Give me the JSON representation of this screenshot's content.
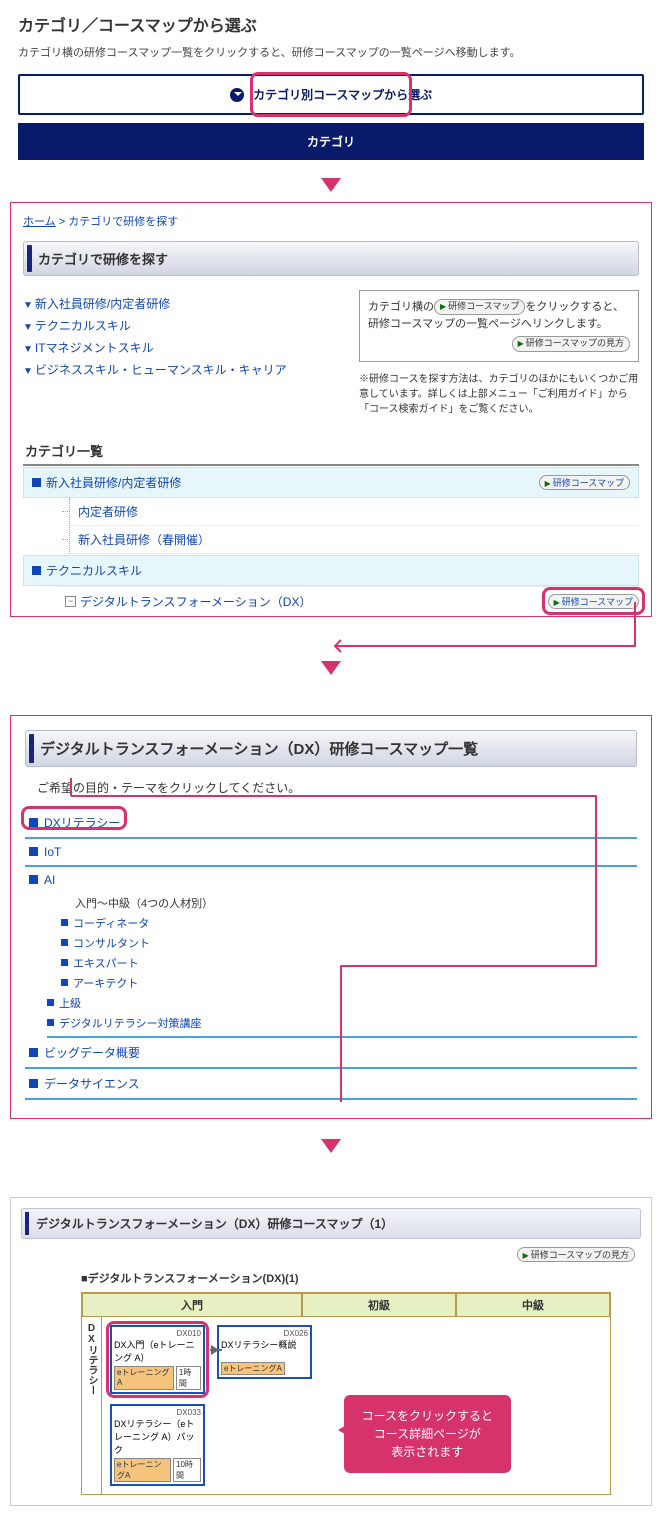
{
  "section1": {
    "title": "カテゴリ／コースマップから選ぶ",
    "desc": "カテゴリ横の研修コースマップ一覧をクリックすると、研修コースマップの一覧ページへ移動します。",
    "btn_map": "カテゴリ別コースマップから選ぶ",
    "btn_category": "カテゴリ"
  },
  "panel1": {
    "breadcrumb_home": "ホーム",
    "breadcrumb_sep": " > ",
    "breadcrumb_current": "カテゴリで研修を探す",
    "heading": "カテゴリで研修を探す",
    "anchors": [
      "新入社員研修/内定者研修",
      "テクニカルスキル",
      "ITマネジメントスキル",
      "ビジネススキル・ヒューマンスキル・キャリア"
    ],
    "info_text_1": "カテゴリ横の",
    "info_chip1": "研修コースマップ",
    "info_text_2": "をクリックすると、研修コースマップの一覧ページへリンクします。",
    "info_chip2": "研修コースマップの見方",
    "note": "※研修コースを探す方法は、カテゴリのほかにもいくつかご用意しています。詳しくは上部メニュー「ご利用ガイド」から「コース検索ガイド」をご覧ください。",
    "cat_heading": "カテゴリ一覧",
    "cat1": "新入社員研修/内定者研修",
    "cat1_chip": "研修コースマップ",
    "cat1_sub1": "内定者研修",
    "cat1_sub2": "新入社員研修（春開催）",
    "cat2": "テクニカルスキル",
    "cat2_node": "デジタルトランスフォーメーション（DX）",
    "cat2_chip": "研修コースマップ"
  },
  "panel2": {
    "heading": "デジタルトランスフォーメーション（DX）研修コースマップ一覧",
    "desc": "ご希望の目的・テーマをクリックしてください。",
    "items": {
      "dx_lit": "DXリテラシー",
      "iot": "IoT",
      "ai": "AI",
      "ai_sub_head": "入門～中級（4つの人材別）",
      "ai_sub1": "コーディネータ",
      "ai_sub2": "コンサルタント",
      "ai_sub3": "エキスパート",
      "ai_sub4": "アーキテクト",
      "ai_upper": "上級",
      "ai_dig": "デジタルリテラシー対策講座",
      "bigdata": "ビッグデータ概要",
      "ds": "データサイエンス"
    }
  },
  "panel3": {
    "heading": "デジタルトランスフォーメーション（DX）研修コースマップ（1）",
    "chip": "研修コースマップの見方",
    "caption": "■デジタルトランスフォーメーション(DX)(1)",
    "levels": {
      "intro": "入門",
      "beginner": "初級",
      "intermediate": "中級"
    },
    "sidelabel": "DXリテラシー",
    "courses": {
      "c1": {
        "id": "DX010",
        "title": "DX入門（eトレーニング A）",
        "tag1": "eトレーニングA",
        "tag2": "1時間"
      },
      "c2": {
        "id": "DX026",
        "title": "DXリテラシー概説",
        "tag1": "eトレーニングA",
        "tag2": ""
      },
      "c3": {
        "id": "DX033",
        "title": "DXリテラシー（eトレーニング A）パック",
        "tag1": "eトレーニングA",
        "tag2": "10時間"
      }
    },
    "callout_l1": "コースをクリックすると",
    "callout_l2": "コース詳細ページが",
    "callout_l3": "表示されます"
  }
}
